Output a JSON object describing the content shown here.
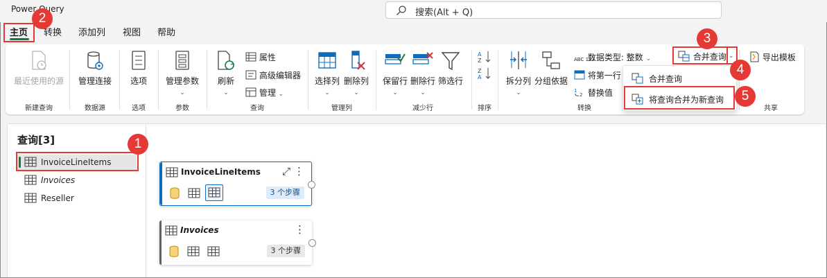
{
  "app": {
    "title": "Power Query"
  },
  "search": {
    "placeholder": "搜索(Alt + Q)"
  },
  "menu_tabs": [
    {
      "label": "主页",
      "active": true
    },
    {
      "label": "转换"
    },
    {
      "label": "添加列"
    },
    {
      "label": "视图"
    },
    {
      "label": "帮助"
    }
  ],
  "ribbon": {
    "recent_sources": "最近使用的源",
    "manage_connections": "管理连接",
    "options": "选项",
    "manage_parameters": "管理参数",
    "refresh": "刷新",
    "properties": "属性",
    "advanced_editor": "高级编辑器",
    "manage": "管理",
    "choose_columns": "选择列",
    "remove_columns": "删除列",
    "keep_rows": "保留行",
    "remove_rows": "删除行",
    "filter_rows": "筛选行",
    "split_column": "拆分列",
    "group_by": "分组依据",
    "data_type": "数据类型: 整数",
    "use_first_row": "将第一行",
    "replace_values": "替换值",
    "merge_queries": "合并查询",
    "export_template": "导出模板",
    "data_type_icon_text": "ABC 123",
    "groups": {
      "new_query": "新建查询",
      "data_sources": "数据源",
      "options": "选项",
      "parameters": "参数",
      "query": "查询",
      "manage_columns": "管理列",
      "reduce_rows": "减少行",
      "sort": "排序",
      "transform": "转换",
      "share": "共享"
    }
  },
  "merge_menu": {
    "items": [
      {
        "label": "合并查询"
      },
      {
        "label": "将查询合并为新查询"
      }
    ]
  },
  "queries_pane": {
    "title": "查询[3]",
    "items": [
      {
        "name": "InvoiceLineItems",
        "selected": true
      },
      {
        "name": "Invoices",
        "italic": true
      },
      {
        "name": "Reseller"
      }
    ]
  },
  "diagram_cards": [
    {
      "name": "InvoiceLineItems",
      "steps": "3 个步骤",
      "accent": "#0f6cbd"
    },
    {
      "name": "Invoices",
      "steps": "3 个步骤",
      "accent": "#616161"
    }
  ],
  "annotations": [
    "1",
    "2",
    "3",
    "4",
    "5"
  ],
  "colors": {
    "accent_green": "#107c41",
    "annotation_red": "#e53935",
    "selected_blue": "#0f6cbd"
  }
}
